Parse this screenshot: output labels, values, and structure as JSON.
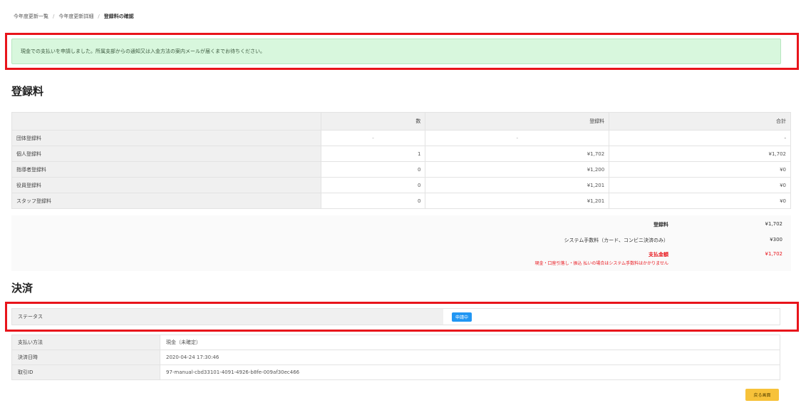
{
  "breadcrumb": {
    "items": [
      "今年度更新一覧",
      "今年度更新詳細",
      "登録料の確認"
    ]
  },
  "alert": {
    "message": "現金での支払いを申請しました。所属支部からの通知又は入金方法の案内メールが届くまでお待ちください。"
  },
  "fee_section": {
    "title": "登録料",
    "columns": [
      "",
      "数",
      "登録料",
      "合計"
    ],
    "rows": [
      {
        "label": "団体登録料",
        "count": "-",
        "fee": "-",
        "total": "-"
      },
      {
        "label": "個人登録料",
        "count": "1",
        "fee": "¥1,702",
        "total": "¥1,702"
      },
      {
        "label": "指導者登録料",
        "count": "0",
        "fee": "¥1,200",
        "total": "¥0"
      },
      {
        "label": "役員登録料",
        "count": "0",
        "fee": "¥1,201",
        "total": "¥0"
      },
      {
        "label": "スタッフ登録料",
        "count": "0",
        "fee": "¥1,201",
        "total": "¥0"
      }
    ],
    "summary": {
      "subtotal_label": "登録料",
      "subtotal_value": "¥1,702",
      "system_fee_label": "システム手数料（カード、コンビニ決済のみ）",
      "system_fee_value": "¥300",
      "total_label": "支払金額",
      "total_value": "¥1,702",
      "note": "現金・口座引落し・振込 払いの場合はシステム手数料はかかりません"
    }
  },
  "payment_section": {
    "title": "決済",
    "status_label": "ステータス",
    "status_badge": "申請中",
    "rows": [
      {
        "label": "支払い方法",
        "value": "現金（未確定）"
      },
      {
        "label": "決済日時",
        "value": "2020-04-24 17:30:46"
      },
      {
        "label": "取引ID",
        "value": "97-manual-cbd33101-4091-4926-b8fe-009af30ec466"
      }
    ]
  },
  "actions": {
    "back_label": "戻る画面"
  },
  "colors": {
    "highlight": "#e8141b",
    "alert_bg": "#d8f7dd",
    "badge": "#2196f3",
    "button": "#f7c23a"
  }
}
